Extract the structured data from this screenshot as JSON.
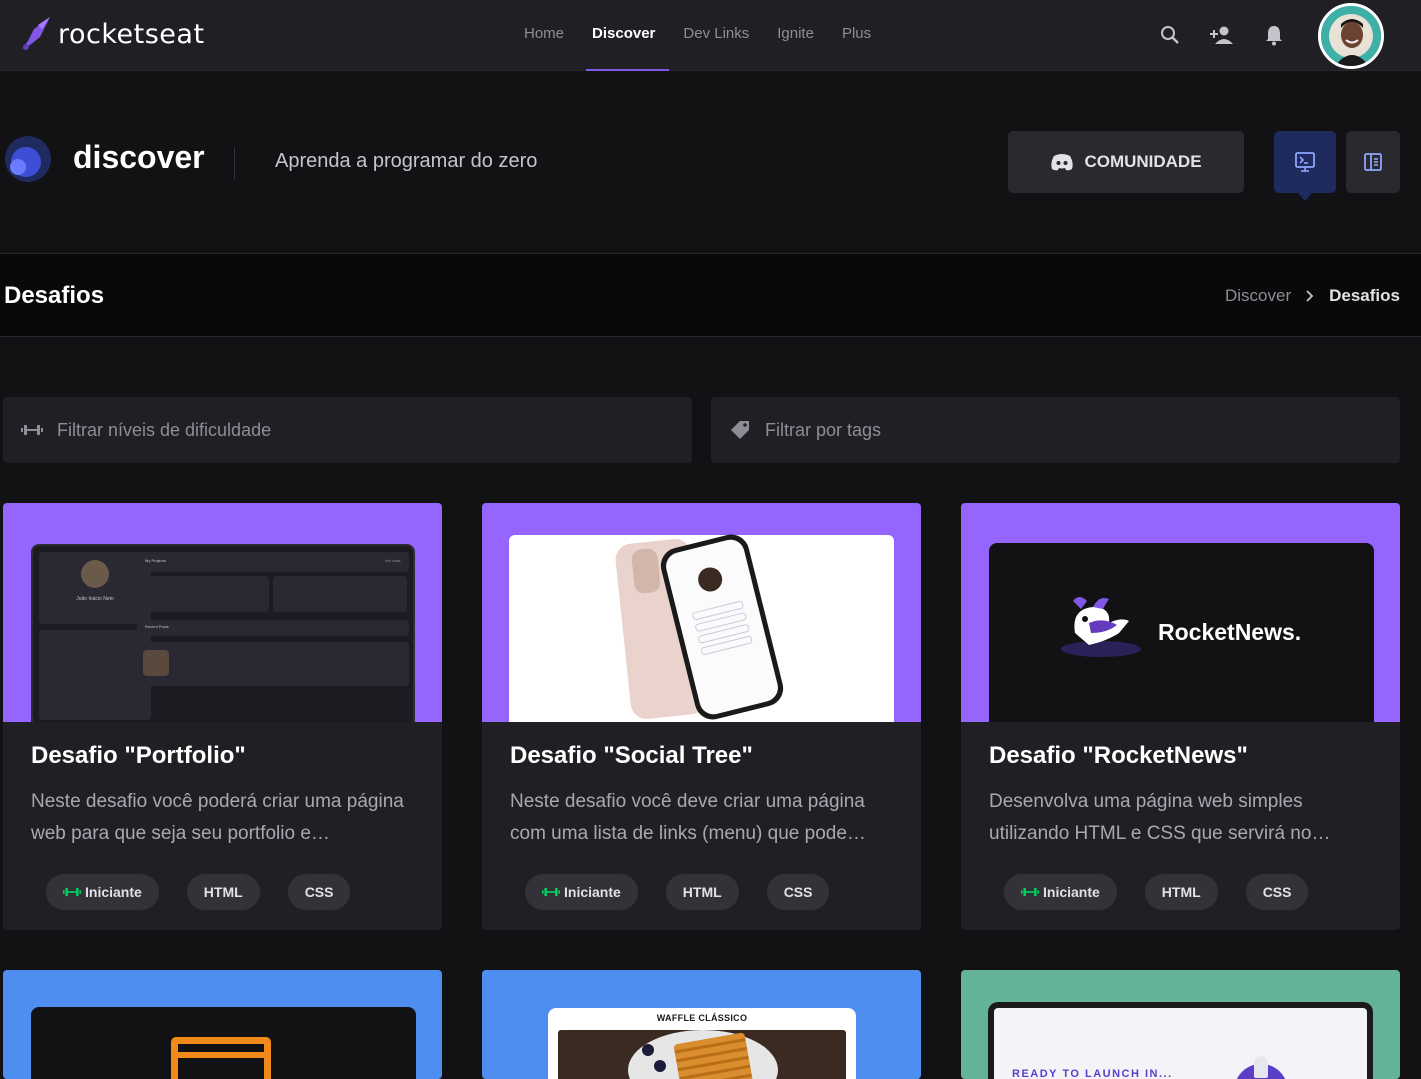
{
  "brand": {
    "name": "rocketseat"
  },
  "nav": {
    "links": [
      {
        "label": "Home"
      },
      {
        "label": "Discover"
      },
      {
        "label": "Dev Links"
      },
      {
        "label": "Ignite"
      },
      {
        "label": "Plus"
      }
    ],
    "active": "Discover"
  },
  "hero": {
    "title": "discover",
    "subtitle": "Aprenda a programar do zero",
    "community_button": "COMUNIDADE"
  },
  "section": {
    "title": "Desafios",
    "breadcrumb": [
      "Discover",
      "Desafios"
    ]
  },
  "filters": {
    "difficulty_placeholder": "Filtrar níveis de dificuldade",
    "tags_placeholder": "Filtrar por tags"
  },
  "cards": [
    {
      "title": "Desafio \"Portfolio\"",
      "description": "Neste desafio você poderá criar uma página web para que seja seu portfolio e…",
      "tags": [
        "Iniciante",
        "HTML",
        "CSS"
      ],
      "thumb_color": "#9466ff",
      "thumb_text": {
        "profile_name": "João Inácio Neto",
        "projects_heading": "My Projects",
        "projects_more": "Ver mais",
        "recent_heading": "Recent Posts"
      }
    },
    {
      "title": "Desafio \"Social Tree\"",
      "description": "Neste desafio você deve criar uma página com uma lista de links (menu) que pode…",
      "tags": [
        "Iniciante",
        "HTML",
        "CSS"
      ],
      "thumb_color": "#9466ff"
    },
    {
      "title": "Desafio \"RocketNews\"",
      "description": "Desenvolva uma página web simples utilizando HTML e CSS que servirá no…",
      "tags": [
        "Iniciante",
        "HTML",
        "CSS"
      ],
      "thumb_color": "#9466ff",
      "thumb_text": "RocketNews."
    },
    {
      "thumb_color": "#4d8ef0"
    },
    {
      "thumb_color": "#4d8ef0",
      "thumb_text": "WAFFLE CLÁSSICO"
    },
    {
      "thumb_color": "#62b39a",
      "thumb_text": "READY TO LAUNCH IN..."
    }
  ],
  "colors": {
    "accent": "#8257e5",
    "level_iniciante": "#04d361",
    "background": "#121214",
    "surface": "#202024"
  },
  "icons": [
    "search-icon",
    "add-user-icon",
    "bell-icon",
    "discord-icon",
    "terminal-icon",
    "panel-icon",
    "dumbbell-icon",
    "tag-icon",
    "chevron-right-icon"
  ]
}
